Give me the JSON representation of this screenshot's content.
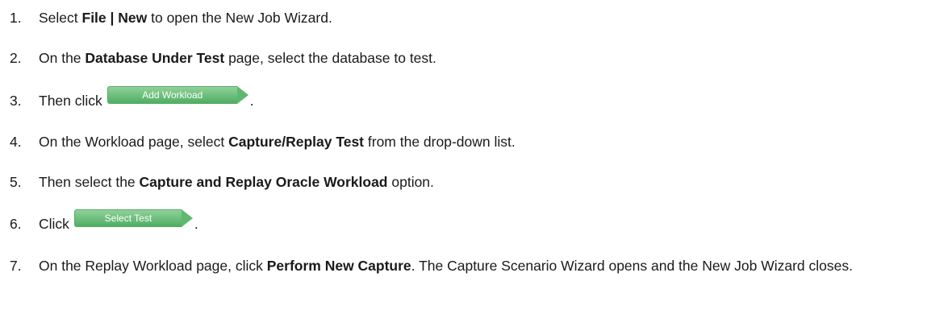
{
  "steps": [
    {
      "num": "1.",
      "pre": "Select ",
      "bold": "File | New",
      "post": " to open the New Job Wizard."
    },
    {
      "num": "2.",
      "pre": "On the ",
      "bold": "Database Under Test",
      "post": " page, select the database to test."
    },
    {
      "num": "3.",
      "pre": "Then click",
      "button": "Add Workload",
      "post": "."
    },
    {
      "num": "4.",
      "pre": "On the Workload page, select ",
      "bold": "Capture/Replay Test",
      "post": " from the drop-down list."
    },
    {
      "num": "5.",
      "pre": "Then select the ",
      "bold": "Capture and Replay Oracle Workload",
      "post": " option."
    },
    {
      "num": "6.",
      "pre": "Click",
      "button": "Select Test",
      "post": "."
    },
    {
      "num": "7.",
      "pre": "On the Replay Workload page, click ",
      "bold": "Perform New Capture",
      "post": ". The Capture Scenario Wizard opens and the New Job Wizard closes."
    }
  ],
  "colors": {
    "button_green": "#5db96e",
    "text": "#1a1a1a"
  }
}
